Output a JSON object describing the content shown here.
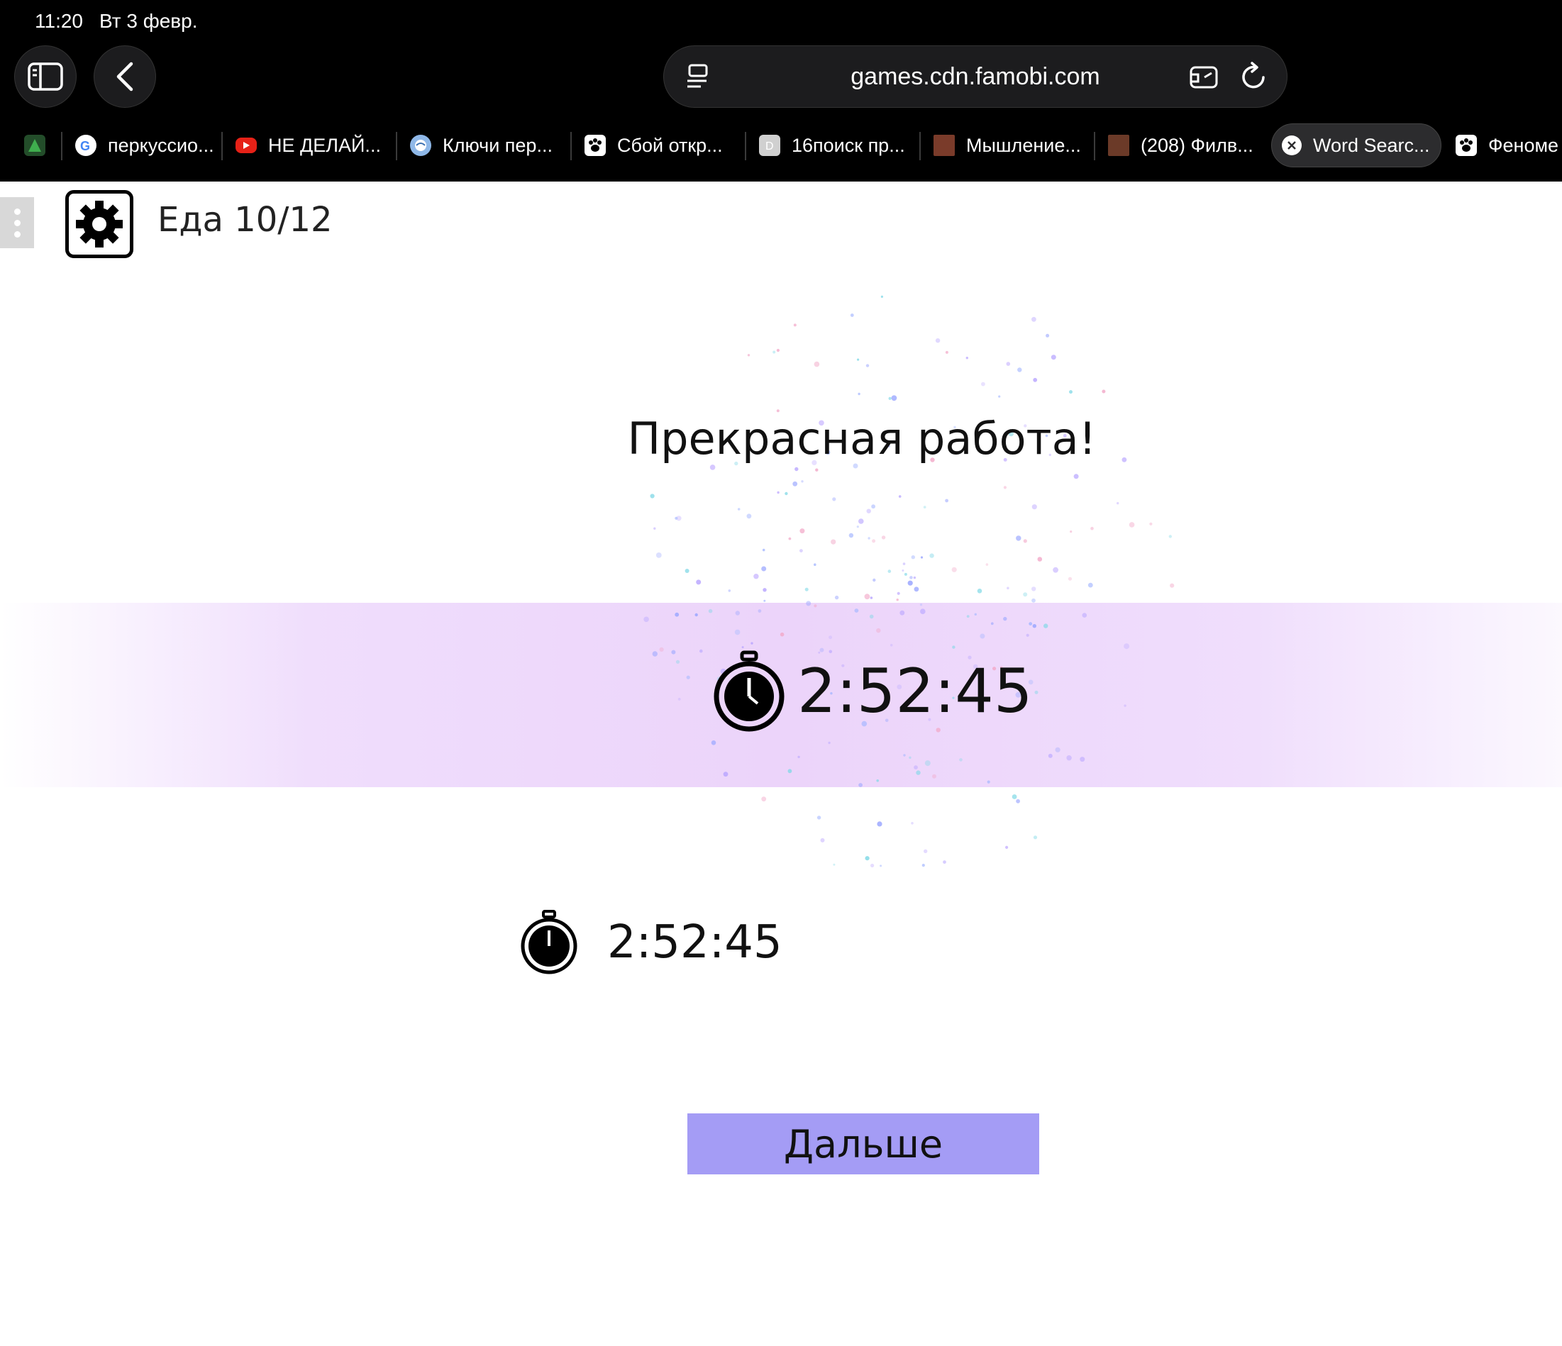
{
  "status_bar": {
    "time": "11:20",
    "date": "Вт 3 февр."
  },
  "browser": {
    "url": "games.cdn.famobi.com",
    "tabs": [
      {
        "label": "",
        "icon": "green-plant-favicon"
      },
      {
        "label": "перкуссио...",
        "icon": "google-favicon"
      },
      {
        "label": "НЕ ДЕЛАЙ...",
        "icon": "youtube-favicon"
      },
      {
        "label": "Ключи пер...",
        "icon": "globe-favicon"
      },
      {
        "label": "Сбой откр...",
        "icon": "paw-favicon"
      },
      {
        "label": "16поиск пр...",
        "icon": "letter-d-favicon"
      },
      {
        "label": "Мышление...",
        "icon": "thumbnail-favicon"
      },
      {
        "label": "(208) Филв...",
        "icon": "thumbnail-favicon"
      },
      {
        "label": "Word Searc...",
        "icon": "close-icon",
        "active": true
      },
      {
        "label": "Феноме",
        "icon": "paw-favicon"
      }
    ]
  },
  "game": {
    "level_title": "Еда 10/12",
    "heading": "Прекрасная работа!",
    "current_time": "2:52:45",
    "best_time": "2:52:45",
    "next_button": "Дальше"
  },
  "colors": {
    "band": "#ecd4fa",
    "button": "#a49cf5"
  }
}
